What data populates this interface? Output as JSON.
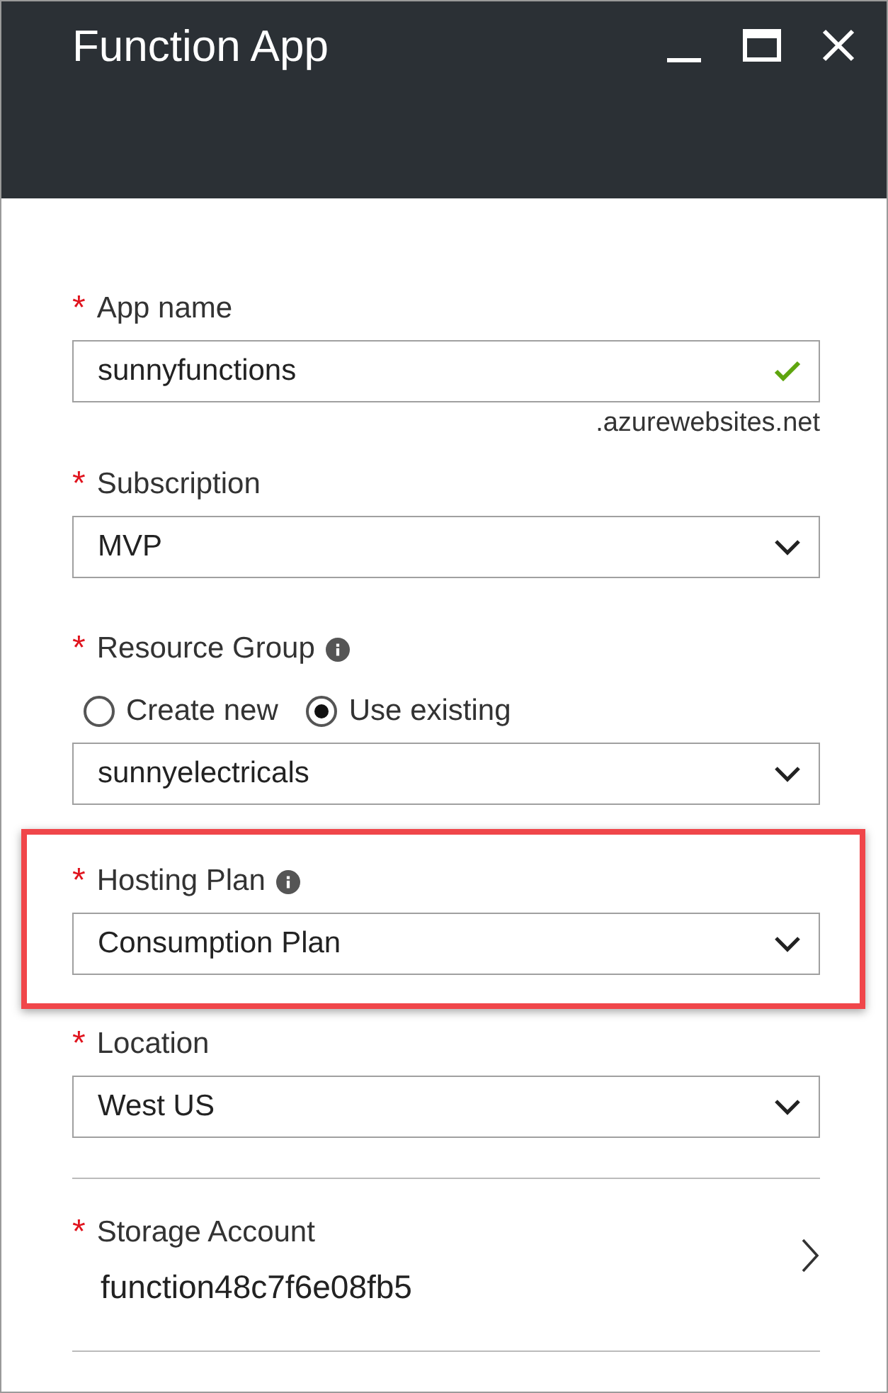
{
  "window": {
    "title": "Function App"
  },
  "fields": [
    {
      "kind": "text",
      "mark": "*",
      "label": "App name",
      "info": false,
      "highlighted": false,
      "value": "sunnyfunctions",
      "valid": true,
      "suffix": ".azurewebsites.net"
    },
    {
      "kind": "select",
      "mark": "*",
      "label": "Subscription",
      "info": false,
      "highlighted": false,
      "value": "MVP"
    },
    {
      "kind": "select",
      "mark": "*",
      "label": "Resource Group",
      "info": true,
      "highlighted": false,
      "options": [
        {
          "label": "Create new",
          "selected": false
        },
        {
          "label": "Use existing",
          "selected": true
        }
      ],
      "value": "sunnyelectricals"
    },
    {
      "kind": "select",
      "mark": "*",
      "label": "Hosting Plan",
      "info": true,
      "highlighted": true,
      "value": "Consumption Plan"
    },
    {
      "kind": "select",
      "mark": "*",
      "label": "Location",
      "info": false,
      "highlighted": false,
      "value": "West US"
    }
  ],
  "storage": {
    "mark": "*",
    "label": "Storage Account",
    "value": "function48c7f6e08fb5"
  }
}
